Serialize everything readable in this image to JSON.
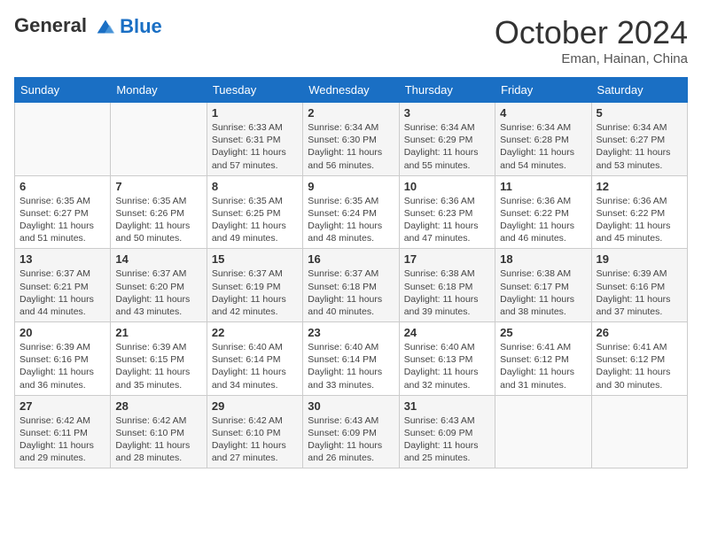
{
  "header": {
    "logo_line1": "General",
    "logo_line2": "Blue",
    "month": "October 2024",
    "location": "Eman, Hainan, China"
  },
  "weekdays": [
    "Sunday",
    "Monday",
    "Tuesday",
    "Wednesday",
    "Thursday",
    "Friday",
    "Saturday"
  ],
  "weeks": [
    [
      {
        "day": "",
        "sunrise": "",
        "sunset": "",
        "daylight": ""
      },
      {
        "day": "",
        "sunrise": "",
        "sunset": "",
        "daylight": ""
      },
      {
        "day": "1",
        "sunrise": "Sunrise: 6:33 AM",
        "sunset": "Sunset: 6:31 PM",
        "daylight": "Daylight: 11 hours and 57 minutes."
      },
      {
        "day": "2",
        "sunrise": "Sunrise: 6:34 AM",
        "sunset": "Sunset: 6:30 PM",
        "daylight": "Daylight: 11 hours and 56 minutes."
      },
      {
        "day": "3",
        "sunrise": "Sunrise: 6:34 AM",
        "sunset": "Sunset: 6:29 PM",
        "daylight": "Daylight: 11 hours and 55 minutes."
      },
      {
        "day": "4",
        "sunrise": "Sunrise: 6:34 AM",
        "sunset": "Sunset: 6:28 PM",
        "daylight": "Daylight: 11 hours and 54 minutes."
      },
      {
        "day": "5",
        "sunrise": "Sunrise: 6:34 AM",
        "sunset": "Sunset: 6:27 PM",
        "daylight": "Daylight: 11 hours and 53 minutes."
      }
    ],
    [
      {
        "day": "6",
        "sunrise": "Sunrise: 6:35 AM",
        "sunset": "Sunset: 6:27 PM",
        "daylight": "Daylight: 11 hours and 51 minutes."
      },
      {
        "day": "7",
        "sunrise": "Sunrise: 6:35 AM",
        "sunset": "Sunset: 6:26 PM",
        "daylight": "Daylight: 11 hours and 50 minutes."
      },
      {
        "day": "8",
        "sunrise": "Sunrise: 6:35 AM",
        "sunset": "Sunset: 6:25 PM",
        "daylight": "Daylight: 11 hours and 49 minutes."
      },
      {
        "day": "9",
        "sunrise": "Sunrise: 6:35 AM",
        "sunset": "Sunset: 6:24 PM",
        "daylight": "Daylight: 11 hours and 48 minutes."
      },
      {
        "day": "10",
        "sunrise": "Sunrise: 6:36 AM",
        "sunset": "Sunset: 6:23 PM",
        "daylight": "Daylight: 11 hours and 47 minutes."
      },
      {
        "day": "11",
        "sunrise": "Sunrise: 6:36 AM",
        "sunset": "Sunset: 6:22 PM",
        "daylight": "Daylight: 11 hours and 46 minutes."
      },
      {
        "day": "12",
        "sunrise": "Sunrise: 6:36 AM",
        "sunset": "Sunset: 6:22 PM",
        "daylight": "Daylight: 11 hours and 45 minutes."
      }
    ],
    [
      {
        "day": "13",
        "sunrise": "Sunrise: 6:37 AM",
        "sunset": "Sunset: 6:21 PM",
        "daylight": "Daylight: 11 hours and 44 minutes."
      },
      {
        "day": "14",
        "sunrise": "Sunrise: 6:37 AM",
        "sunset": "Sunset: 6:20 PM",
        "daylight": "Daylight: 11 hours and 43 minutes."
      },
      {
        "day": "15",
        "sunrise": "Sunrise: 6:37 AM",
        "sunset": "Sunset: 6:19 PM",
        "daylight": "Daylight: 11 hours and 42 minutes."
      },
      {
        "day": "16",
        "sunrise": "Sunrise: 6:37 AM",
        "sunset": "Sunset: 6:18 PM",
        "daylight": "Daylight: 11 hours and 40 minutes."
      },
      {
        "day": "17",
        "sunrise": "Sunrise: 6:38 AM",
        "sunset": "Sunset: 6:18 PM",
        "daylight": "Daylight: 11 hours and 39 minutes."
      },
      {
        "day": "18",
        "sunrise": "Sunrise: 6:38 AM",
        "sunset": "Sunset: 6:17 PM",
        "daylight": "Daylight: 11 hours and 38 minutes."
      },
      {
        "day": "19",
        "sunrise": "Sunrise: 6:39 AM",
        "sunset": "Sunset: 6:16 PM",
        "daylight": "Daylight: 11 hours and 37 minutes."
      }
    ],
    [
      {
        "day": "20",
        "sunrise": "Sunrise: 6:39 AM",
        "sunset": "Sunset: 6:16 PM",
        "daylight": "Daylight: 11 hours and 36 minutes."
      },
      {
        "day": "21",
        "sunrise": "Sunrise: 6:39 AM",
        "sunset": "Sunset: 6:15 PM",
        "daylight": "Daylight: 11 hours and 35 minutes."
      },
      {
        "day": "22",
        "sunrise": "Sunrise: 6:40 AM",
        "sunset": "Sunset: 6:14 PM",
        "daylight": "Daylight: 11 hours and 34 minutes."
      },
      {
        "day": "23",
        "sunrise": "Sunrise: 6:40 AM",
        "sunset": "Sunset: 6:14 PM",
        "daylight": "Daylight: 11 hours and 33 minutes."
      },
      {
        "day": "24",
        "sunrise": "Sunrise: 6:40 AM",
        "sunset": "Sunset: 6:13 PM",
        "daylight": "Daylight: 11 hours and 32 minutes."
      },
      {
        "day": "25",
        "sunrise": "Sunrise: 6:41 AM",
        "sunset": "Sunset: 6:12 PM",
        "daylight": "Daylight: 11 hours and 31 minutes."
      },
      {
        "day": "26",
        "sunrise": "Sunrise: 6:41 AM",
        "sunset": "Sunset: 6:12 PM",
        "daylight": "Daylight: 11 hours and 30 minutes."
      }
    ],
    [
      {
        "day": "27",
        "sunrise": "Sunrise: 6:42 AM",
        "sunset": "Sunset: 6:11 PM",
        "daylight": "Daylight: 11 hours and 29 minutes."
      },
      {
        "day": "28",
        "sunrise": "Sunrise: 6:42 AM",
        "sunset": "Sunset: 6:10 PM",
        "daylight": "Daylight: 11 hours and 28 minutes."
      },
      {
        "day": "29",
        "sunrise": "Sunrise: 6:42 AM",
        "sunset": "Sunset: 6:10 PM",
        "daylight": "Daylight: 11 hours and 27 minutes."
      },
      {
        "day": "30",
        "sunrise": "Sunrise: 6:43 AM",
        "sunset": "Sunset: 6:09 PM",
        "daylight": "Daylight: 11 hours and 26 minutes."
      },
      {
        "day": "31",
        "sunrise": "Sunrise: 6:43 AM",
        "sunset": "Sunset: 6:09 PM",
        "daylight": "Daylight: 11 hours and 25 minutes."
      },
      {
        "day": "",
        "sunrise": "",
        "sunset": "",
        "daylight": ""
      },
      {
        "day": "",
        "sunrise": "",
        "sunset": "",
        "daylight": ""
      }
    ]
  ]
}
